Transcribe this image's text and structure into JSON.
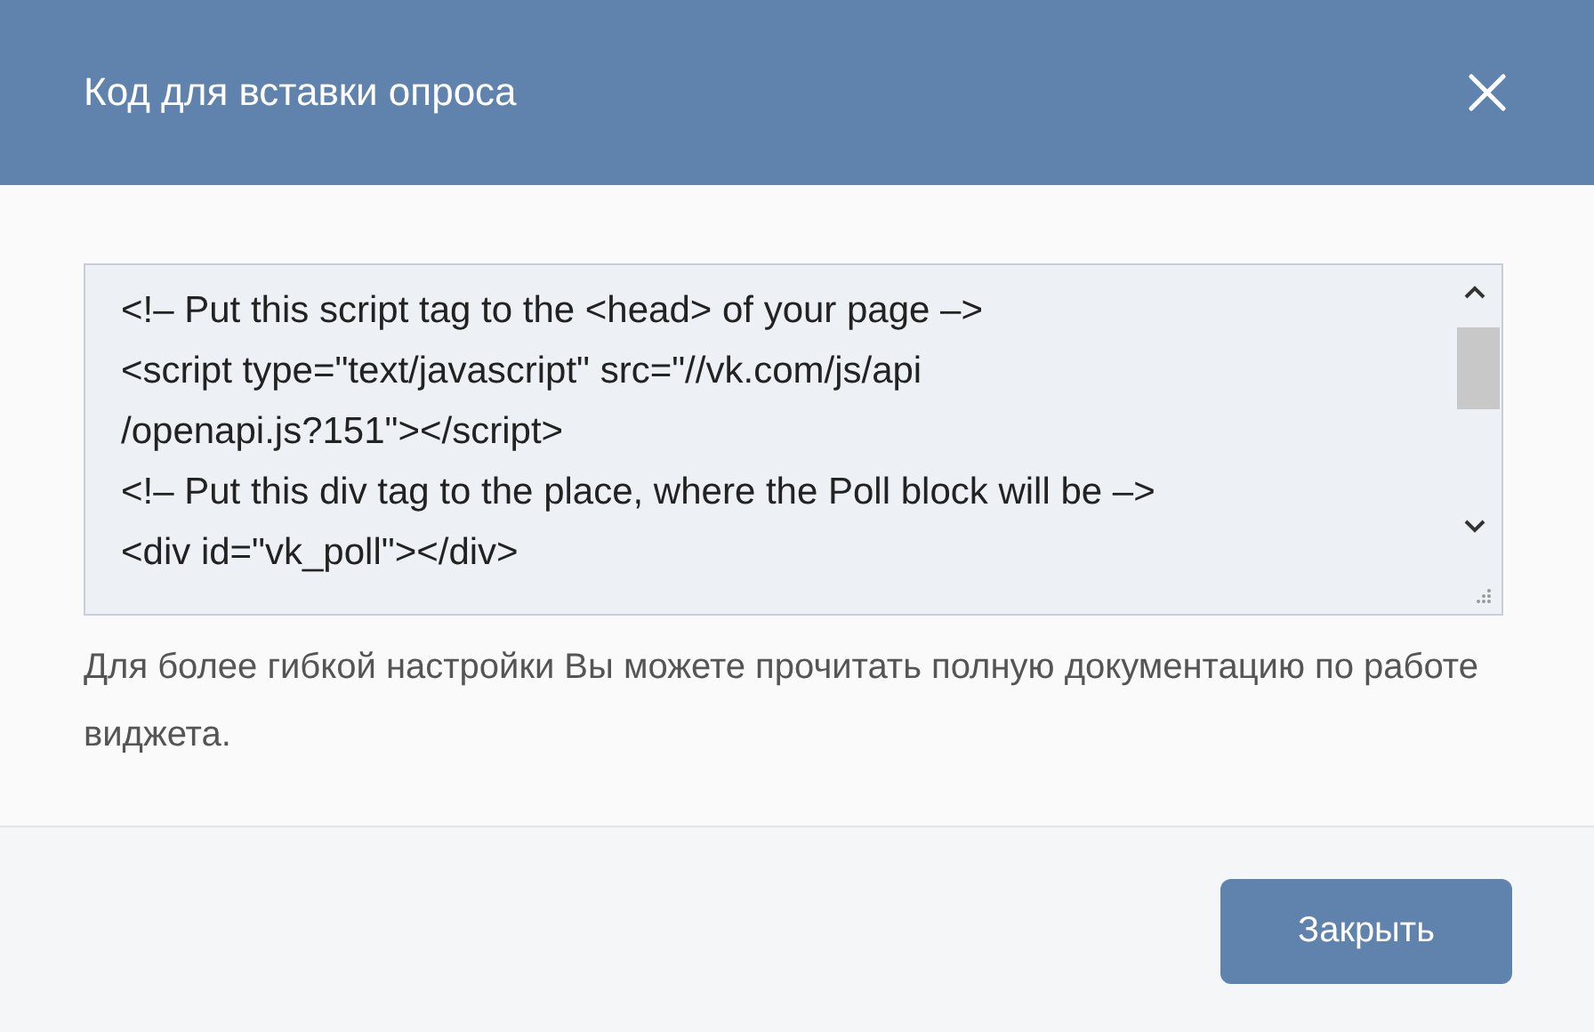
{
  "window": {
    "title": "Код для вставки опроса"
  },
  "code": {
    "lines": [
      "<!– Put this script tag to the <head> of your page –>",
      "<script type=\"text/javascript\" src=\"//vk.com/js/api",
      "/openapi.js?151\"></script>",
      "<!– Put this div tag to the place, where the Poll block will be –>",
      "<div id=\"vk_poll\"></div>"
    ]
  },
  "description": "Для более гибкой настройки Вы можете прочитать полную документацию по работе виджета.",
  "buttons": [
    "Закрыть"
  ]
}
